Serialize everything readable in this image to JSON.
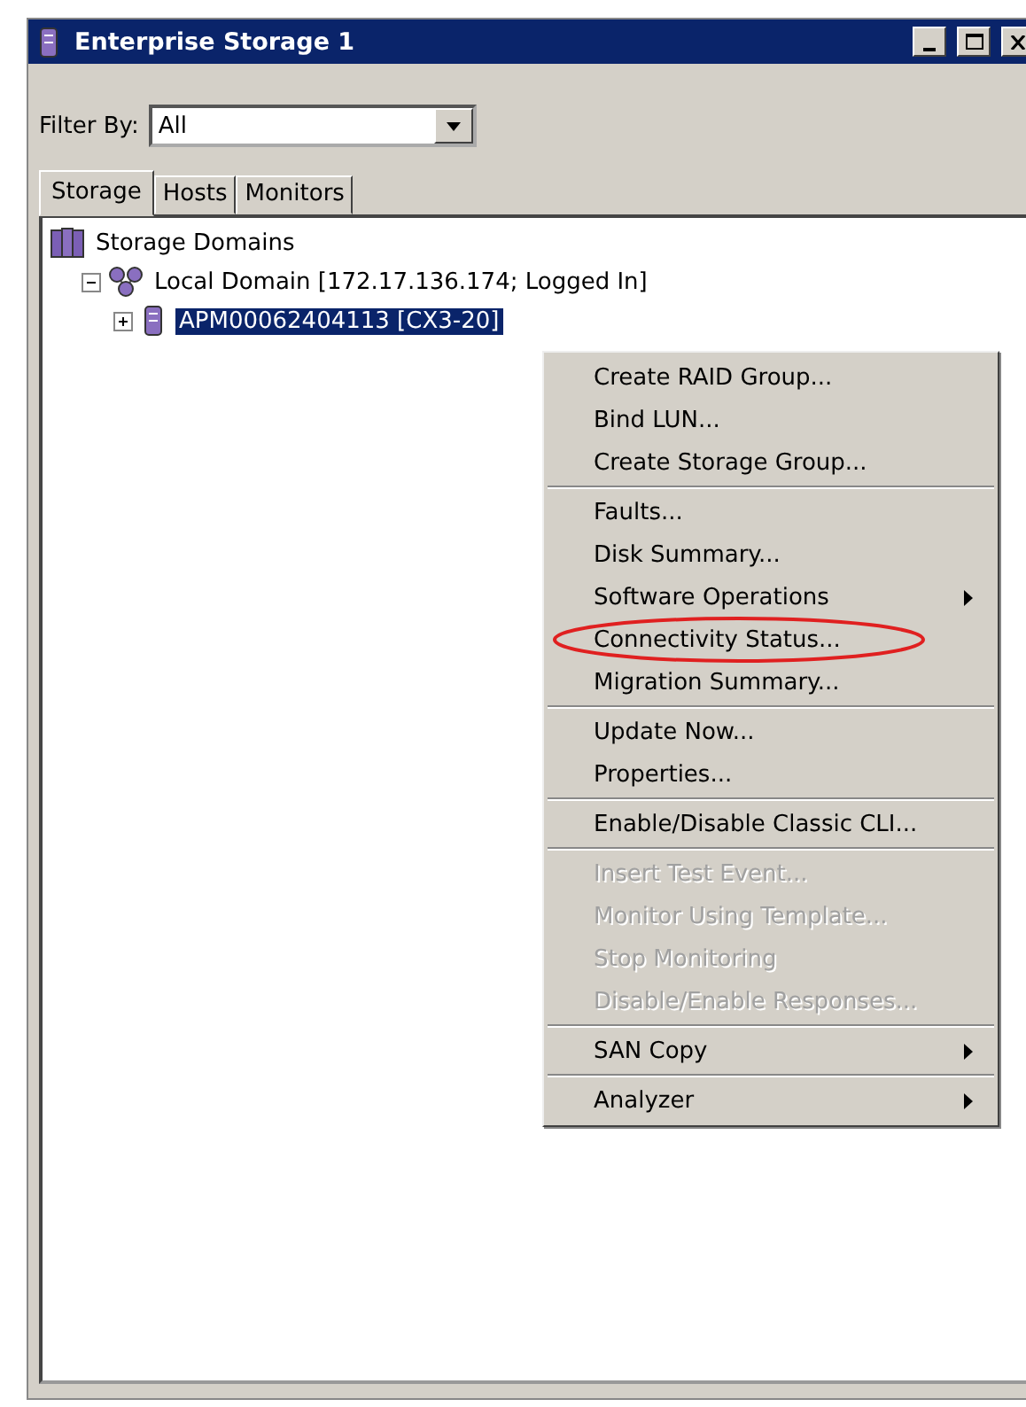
{
  "window": {
    "title": "Enterprise Storage 1"
  },
  "filter": {
    "label": "Filter By:",
    "value": "All"
  },
  "tabs": [
    {
      "label": "Storage",
      "selected": true
    },
    {
      "label": "Hosts",
      "selected": false
    },
    {
      "label": "Monitors",
      "selected": false
    }
  ],
  "tree": [
    {
      "label": "Storage Domains",
      "selected": false,
      "children": [
        {
          "label": "Local Domain [172.17.136.174; Logged In]",
          "selected": false,
          "expanded": true,
          "children": [
            {
              "label": "APM00062404113 [CX3-20]",
              "selected": true,
              "expanded": false
            }
          ]
        }
      ]
    }
  ],
  "context_menu": {
    "groups": [
      [
        {
          "label": "Create RAID Group...",
          "disabled": false,
          "submenu": false,
          "circled": false
        },
        {
          "label": "Bind LUN...",
          "disabled": false,
          "submenu": false,
          "circled": false
        },
        {
          "label": "Create Storage Group...",
          "disabled": false,
          "submenu": false,
          "circled": false
        }
      ],
      [
        {
          "label": "Faults...",
          "disabled": false,
          "submenu": false,
          "circled": false
        },
        {
          "label": "Disk Summary...",
          "disabled": false,
          "submenu": false,
          "circled": false
        },
        {
          "label": "Software Operations",
          "disabled": false,
          "submenu": true,
          "circled": false
        },
        {
          "label": "Connectivity Status...",
          "disabled": false,
          "submenu": false,
          "circled": true
        },
        {
          "label": "Migration Summary...",
          "disabled": false,
          "submenu": false,
          "circled": false
        }
      ],
      [
        {
          "label": "Update Now...",
          "disabled": false,
          "submenu": false,
          "circled": false
        },
        {
          "label": "Properties...",
          "disabled": false,
          "submenu": false,
          "circled": false
        }
      ],
      [
        {
          "label": "Enable/Disable Classic CLI...",
          "disabled": false,
          "submenu": false,
          "circled": false
        }
      ],
      [
        {
          "label": "Insert Test Event...",
          "disabled": true,
          "submenu": false,
          "circled": false
        },
        {
          "label": "Monitor Using Template...",
          "disabled": true,
          "submenu": false,
          "circled": false
        },
        {
          "label": "Stop Monitoring",
          "disabled": true,
          "submenu": false,
          "circled": false
        },
        {
          "label": "Disable/Enable Responses...",
          "disabled": true,
          "submenu": false,
          "circled": false
        }
      ],
      [
        {
          "label": "SAN Copy",
          "disabled": false,
          "submenu": true,
          "circled": false
        }
      ],
      [
        {
          "label": "Analyzer",
          "disabled": false,
          "submenu": true,
          "circled": false
        }
      ]
    ]
  }
}
